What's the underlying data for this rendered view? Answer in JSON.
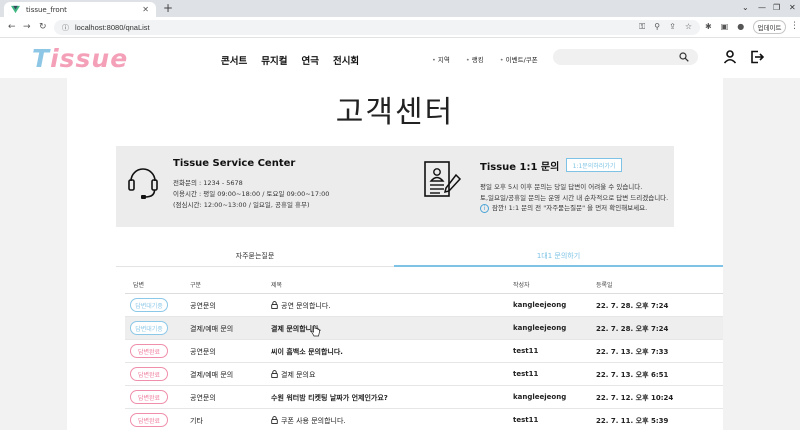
{
  "browser": {
    "tab_title": "tissue_front",
    "url": "localhost:8080/qnaList",
    "update_label": "업데이트"
  },
  "site": {
    "logo_t": "T",
    "logo_rest": "issue",
    "nav": [
      "콘서트",
      "뮤지컬",
      "연극",
      "전시회"
    ],
    "subnav": [
      "지역",
      "랭킹",
      "이벤트/쿠폰"
    ]
  },
  "page": {
    "title": "고객센터",
    "service": {
      "title": "Tissue Service Center",
      "phone": "전화문의 : 1234 - 5678",
      "hours": "이용시간 : 평일 09:00~18:00 / 토요일 09:00~17:00",
      "lunch": "(점심시간: 12:00~13:00 / 일요일, 공휴일 휴무)"
    },
    "inquiry": {
      "title": "Tissue 1:1 문의",
      "button": "1:1문의하러가기",
      "line1": "평일 오후 5시 이후 문의는 당일 답변이 어려울 수 있습니다.",
      "line2": "토,일요일/공휴일 문의는 운영 시간 내 순차적으로 답변 드리겠습니다.",
      "notice": "잠깐! 1:1 문의 전 \"자주묻는질문\" 을 먼저 확인해보세요."
    },
    "tabs": {
      "faq": "자주묻는질문",
      "qna": "1대1 문의하기"
    },
    "table": {
      "headers": {
        "status": "답변",
        "category": "구분",
        "subject": "제목",
        "author": "작성자",
        "date": "등록일"
      },
      "rows": [
        {
          "status": "답변대기중",
          "category": "공연문의",
          "subject": "공연 문의합니다.",
          "author": "kangleejeong",
          "date": "22. 7. 28. 오후 7:24"
        },
        {
          "status": "답변대기중",
          "category": "결제/예매 문의",
          "subject": "결제 문의합니다.",
          "author": "kangleejeong",
          "date": "22. 7. 28. 오후 7:24"
        },
        {
          "status": "답변완료",
          "category": "공연문의",
          "subject": "씨이 흠백소 문의합니다.",
          "author": "test11",
          "date": "22. 7. 13. 오후 7:33"
        },
        {
          "status": "답변완료",
          "category": "결제/예매 문의",
          "subject": "결제 문의요",
          "author": "test11",
          "date": "22. 7. 13. 오후 6:51"
        },
        {
          "status": "답변완료",
          "category": "공연문의",
          "subject": "수원 워터밤 티켓팅 날짜가 언제인가요?",
          "author": "kangleejeong",
          "date": "22. 7. 12. 오후 10:24"
        },
        {
          "status": "답변완료",
          "category": "기타",
          "subject": "쿠폰 사용 문의합니다.",
          "author": "test11",
          "date": "22. 7. 11. 오후 5:39"
        }
      ]
    }
  },
  "colors": {
    "accent_blue": "#7ec3e5",
    "accent_pink": "#ef7c9c"
  }
}
